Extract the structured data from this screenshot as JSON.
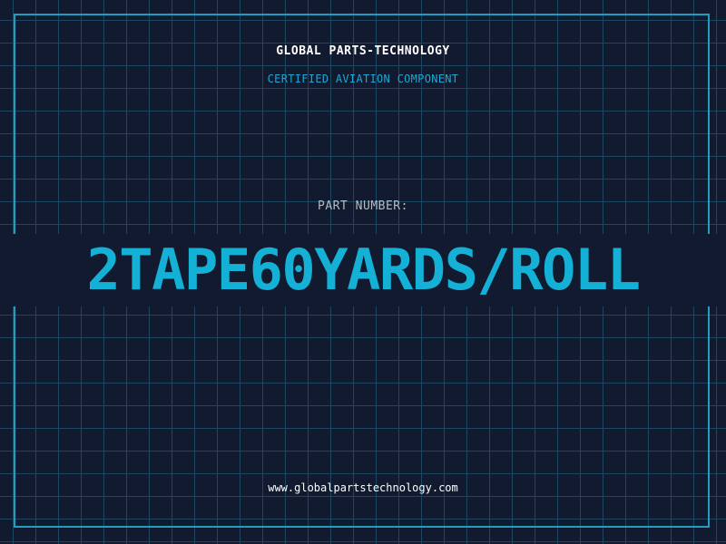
{
  "header": {
    "company_name": "GLOBAL PARTS-TECHNOLOGY",
    "tagline": "CERTIFIED AVIATION COMPONENT"
  },
  "part": {
    "label": "PART NUMBER:",
    "number": "2TAPE60YARDS/ROLL"
  },
  "footer": {
    "website": "www.globalpartstechnology.com"
  },
  "colors": {
    "background": "#111a2e",
    "grid": "#1c4761",
    "frame": "#1f9fc0",
    "accent": "#15b0d6"
  }
}
